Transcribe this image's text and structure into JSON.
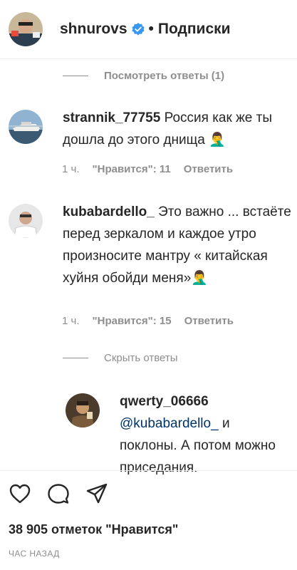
{
  "header": {
    "username": "shnurovs",
    "separator": "•",
    "follow_label": "Подписки"
  },
  "threads": {
    "view_replies": "Посмотреть ответы (1)",
    "hide_replies": "Скрыть ответы"
  },
  "comments": [
    {
      "author": "strannik_77755",
      "text": "Россия как же ты дошла до этого днища 🤦‍♂",
      "time": "1 ч.",
      "likes": "\"Нравится\": 11",
      "reply_label": "Ответить"
    },
    {
      "author": "kubabardello_",
      "text": "Это важно ... встаёте перед зеркалом и каждое утро произносите мантру « китайская хуйня обойди меня»🤦‍♂",
      "time": "1 ч.",
      "likes": "\"Нравится\": 15",
      "reply_label": "Ответить"
    }
  ],
  "reply": {
    "author": "qwerty_06666",
    "mention": "@kubabardello_",
    "text": "и поклоны. А потом можно приседания."
  },
  "footer": {
    "likes_total": "38 905 отметок \"Нравится\"",
    "timestamp": "ЧАС НАЗАД"
  },
  "icons": {
    "verified": "verified-badge-icon",
    "like": "heart-icon",
    "comment": "comment-bubble-icon",
    "share": "paper-plane-icon"
  },
  "colors": {
    "verified": "#3897f0",
    "text": "#262626",
    "muted": "#8e8e8e",
    "mention": "#003569"
  }
}
